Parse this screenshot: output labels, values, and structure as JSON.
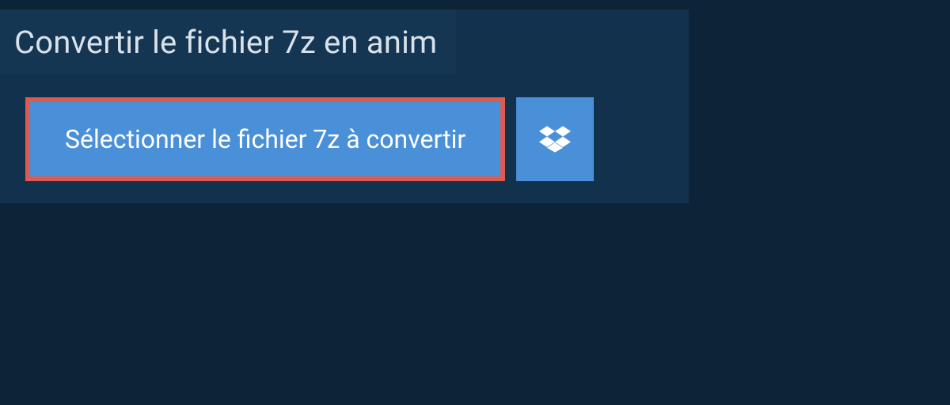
{
  "title": "Convertir le fichier 7z en anim",
  "select_button_label": "Sélectionner le fichier 7z à convertir"
}
